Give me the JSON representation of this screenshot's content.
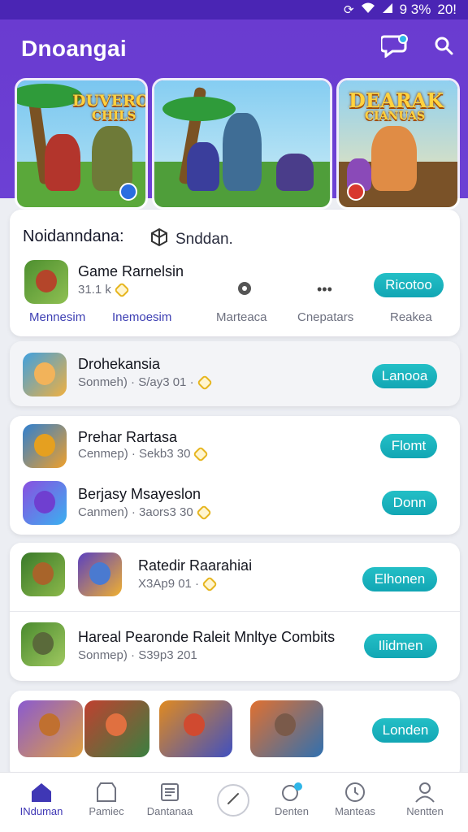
{
  "status_bar": {
    "battery": "9 3%",
    "time": "20!"
  },
  "app_title": "Dnoangai",
  "banners": [
    {
      "title_line1": "DUVEROAN",
      "title_line2": "CHILS"
    },
    {
      "title_line1": "",
      "title_line2": ""
    },
    {
      "title_line1": "DEARAK",
      "title_line2": "CIANUAS"
    }
  ],
  "featured": {
    "section_title": "Noidanndana:",
    "section_sub": "Snddan.",
    "app": {
      "name": "Game Rarnelsin",
      "meta": "31.1 k",
      "button": "Ricotoo"
    },
    "tabs": [
      "Mennesim",
      "Inemoesim",
      "Marteaca",
      "Cnepatars",
      "Reakea"
    ]
  },
  "list": [
    {
      "name": "Drohekansia",
      "meta": "Sonmeh) · S/ay3 01 ·",
      "button": "Lanooa"
    },
    {
      "name": "Prehar Rartasa",
      "meta": "Cenmep) · Sekb3 30",
      "button": "Flomt"
    },
    {
      "name": "Berjasy Msayeslon",
      "meta": "Canmen) · 3aors3 30",
      "button": "Donn"
    },
    {
      "name": "Ratedir Raarahiai",
      "meta": "X3Ap9 01 ·",
      "button": "Elhonen"
    },
    {
      "name": "Hareal Pearonde Raleit Mnltye Combits",
      "meta": "Sonmep) · S39p3 201",
      "button": "Ilidmen"
    },
    {
      "name": "",
      "meta": "",
      "button": "Londen"
    }
  ],
  "bottom_nav": [
    {
      "label": "INduman",
      "icon": "home-icon"
    },
    {
      "label": "Pamiec",
      "icon": "shop-icon"
    },
    {
      "label": "Dantanaa",
      "icon": "library-icon"
    },
    {
      "label": "",
      "icon": "compass-icon"
    },
    {
      "label": "Denten",
      "icon": "gamepad-icon"
    },
    {
      "label": "Manteas",
      "icon": "clock-icon"
    },
    {
      "label": "Nentten",
      "icon": "profile-icon"
    }
  ],
  "colors": {
    "header": "#6a3bd0",
    "accent": "#1eb3c0",
    "active_tab": "#3d3fb3"
  }
}
